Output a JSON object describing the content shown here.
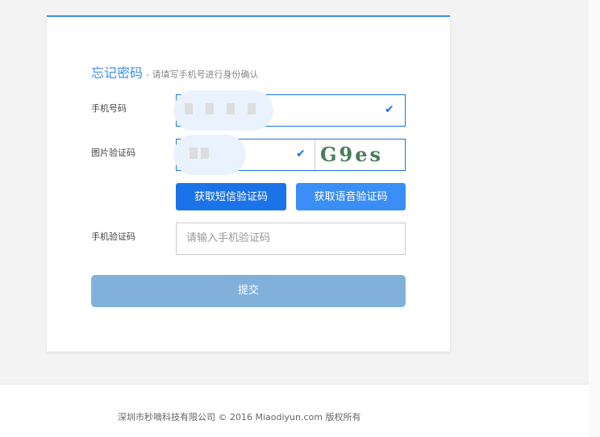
{
  "form": {
    "title": "忘记密码",
    "subtitle": "- 请填写手机号进行身份确认",
    "phone_label": "手机号码",
    "captcha_label": "图片验证码",
    "captcha_text": "G9es",
    "sms_btn": "获取短信验证码",
    "voice_btn": "获取语音验证码",
    "sms_label": "手机验证码",
    "sms_placeholder": "请输入手机验证码",
    "submit": "提交",
    "check_icon": "✔"
  },
  "footer": {
    "copyright": "深圳市秒嘀科技有限公司 © 2016 Miaodiyun.com 版权所有"
  },
  "colors": {
    "accent": "#3a8ef6",
    "button": "#1a73e8",
    "submit": "#81b1db"
  }
}
